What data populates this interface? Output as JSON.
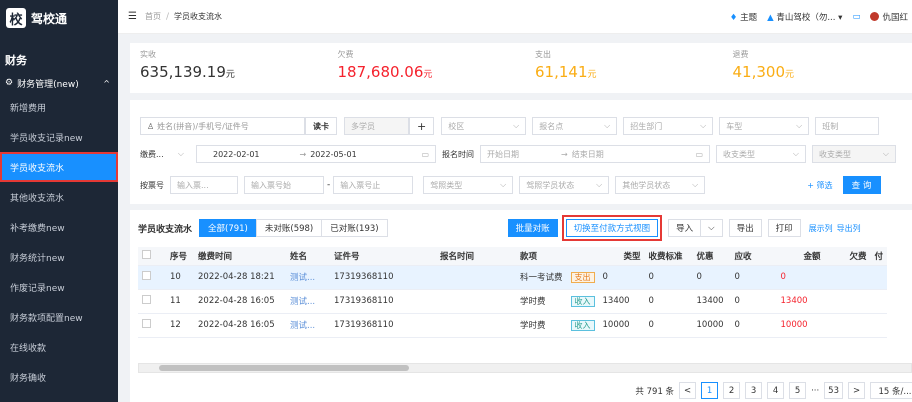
{
  "brand": {
    "badge": "校",
    "name": "驾校通"
  },
  "sidebar": {
    "section": "财务",
    "group": "财务管理(new)",
    "items": [
      {
        "label": "新增费用"
      },
      {
        "label": "学员收支记录new"
      },
      {
        "label": "学员收支流水"
      },
      {
        "label": "其他收支流水"
      },
      {
        "label": "补考缴费new"
      },
      {
        "label": "财务统计new"
      },
      {
        "label": "作废记录new"
      },
      {
        "label": "财务款项配置new"
      },
      {
        "label": "在线收款"
      },
      {
        "label": "财务确收"
      }
    ]
  },
  "topbar": {
    "home": "首页",
    "current": "学员收支流水",
    "theme": "主题",
    "school": "青山驾校（勿...",
    "user": "仇国红"
  },
  "stats": [
    {
      "label": "实收",
      "value": "635,139.19",
      "unit": "元",
      "color": "#333333"
    },
    {
      "label": "欠费",
      "value": "187,680.06",
      "unit": "元",
      "color": "#f5222d"
    },
    {
      "label": "支出",
      "value": "61,141",
      "unit": "元",
      "color": "#faad14"
    },
    {
      "label": "退费",
      "value": "41,300",
      "unit": "元",
      "color": "#faad14"
    }
  ],
  "filters": {
    "search_placeholder": "姓名(拼音)/手机号/证件号",
    "read_card": "读卡",
    "multi_student": "多学员",
    "plus": "+",
    "campus": "校区",
    "enroll_point": "报名点",
    "recruit_dept": "招生部门",
    "car_type": "车型",
    "class_type": "班制",
    "pay_label": "缴费...",
    "date_start": "2022-02-01",
    "date_to": "→",
    "date_end": "2022-05-01",
    "enroll_time_label": "报名时间",
    "enroll_start": "开始日期",
    "enroll_end": "结束日期",
    "flow_type": "收支类型",
    "flow_type2": "收支类型",
    "ticket_label": "按票号",
    "ticket_input": "输入票...",
    "ticket_start": "输入票号始",
    "ticket_dash": "-",
    "ticket_end": "输入票号止",
    "license_type": "驾照类型",
    "license_status": "驾照学员状态",
    "other_status": "其他学员状态",
    "filter_link": "+ 筛选",
    "query": "查 询"
  },
  "table_bar": {
    "title": "学员收支流水",
    "tabs": [
      {
        "label": "全部(791)"
      },
      {
        "label": "未对账(598)"
      },
      {
        "label": "已对账(193)"
      }
    ],
    "batch": "批量对账",
    "switch": "切换至付款方式视图",
    "import": "导入",
    "export": "导出",
    "print": "打印",
    "show_cols": "展示列",
    "export_cols": "导出列"
  },
  "table": {
    "headers": [
      "",
      "序号",
      "缴费时间",
      "姓名",
      "证件号",
      "报名时间",
      "款项",
      "",
      "类型",
      "收费标准",
      "优惠",
      "应收",
      "金额",
      "欠费",
      "付"
    ],
    "rows": [
      {
        "no": "10",
        "time": "2022-04-28 18:21",
        "name": "测试...",
        "id": "17319368110",
        "item": "科一考试费",
        "tag": "支出",
        "type": "0",
        "std": "0",
        "disc": "0",
        "due": "0",
        "amt": "0",
        "owe": ""
      },
      {
        "no": "11",
        "time": "2022-04-28 16:05",
        "name": "测试...",
        "id": "17319368110",
        "item": "学时费",
        "tag": "收入",
        "type": "13400",
        "std": "0",
        "disc": "13400",
        "due": "0",
        "amt": "13400",
        "owe": ""
      },
      {
        "no": "12",
        "time": "2022-04-28 16:05",
        "name": "测试...",
        "id": "17319368110",
        "item": "学时费",
        "tag": "收入",
        "type": "10000",
        "std": "0",
        "disc": "10000",
        "due": "0",
        "amt": "10000",
        "owe": ""
      }
    ]
  },
  "pager": {
    "total": "共 791 条",
    "prev": "<",
    "pages": [
      "1",
      "2",
      "3",
      "4",
      "5",
      "···",
      "53"
    ],
    "next": ">",
    "size": "15 条/..."
  }
}
